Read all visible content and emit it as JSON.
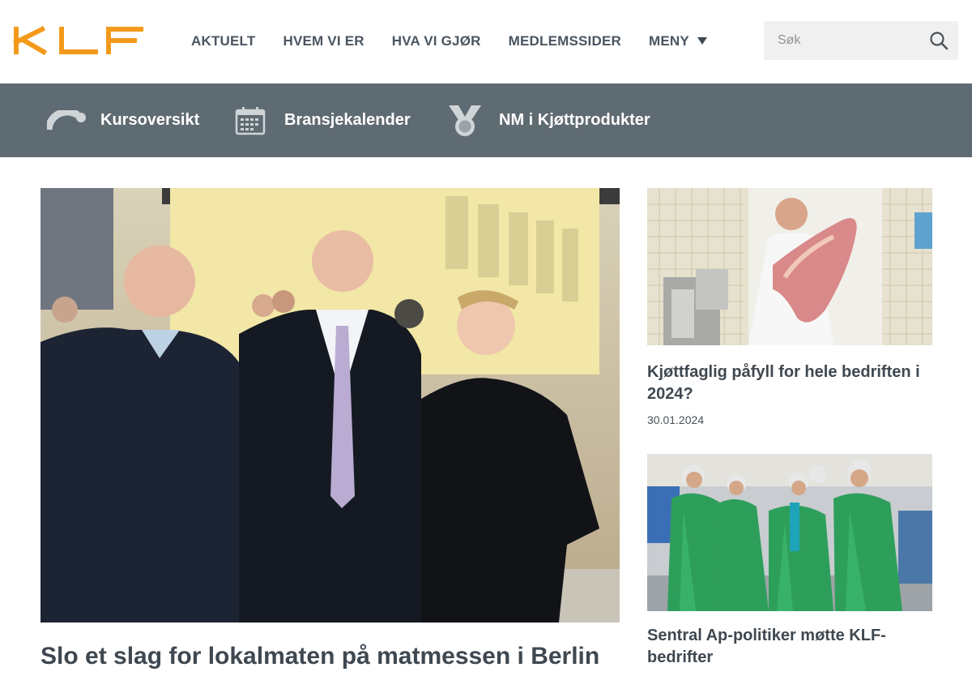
{
  "brand": {
    "logo_text": "KLF",
    "accent": "#f39a1b"
  },
  "nav": {
    "items": [
      "AKTUELT",
      "HVEM VI ER",
      "HVA VI GJØR",
      "MEDLEMSSIDER",
      "MENY"
    ],
    "menu_icon": "caret-down-icon"
  },
  "search": {
    "placeholder": "Søk",
    "icon": "search-icon"
  },
  "quicklinks": {
    "bar_color": "#5f6b72",
    "items": [
      {
        "label": "Kursoversikt",
        "icon": "course-icon"
      },
      {
        "label": "Bransjekalender",
        "icon": "calendar-icon"
      },
      {
        "label": "NM i Kjøttprodukter",
        "icon": "medal-icon"
      }
    ]
  },
  "articles": {
    "main": {
      "title": "Slo et slag for lokalmaten på matmessen i Berlin",
      "image": "photo-people-at-food-fair"
    },
    "side": [
      {
        "title": "Kjøttfaglig påfyll for hele bedriften i 2024?",
        "date": "30.01.2024",
        "image": "photo-butcher-carrying-meat"
      },
      {
        "title": "Sentral Ap-politiker møtte KLF-bedrifter",
        "image": "photo-visitors-in-green-protective-gear"
      }
    ]
  }
}
